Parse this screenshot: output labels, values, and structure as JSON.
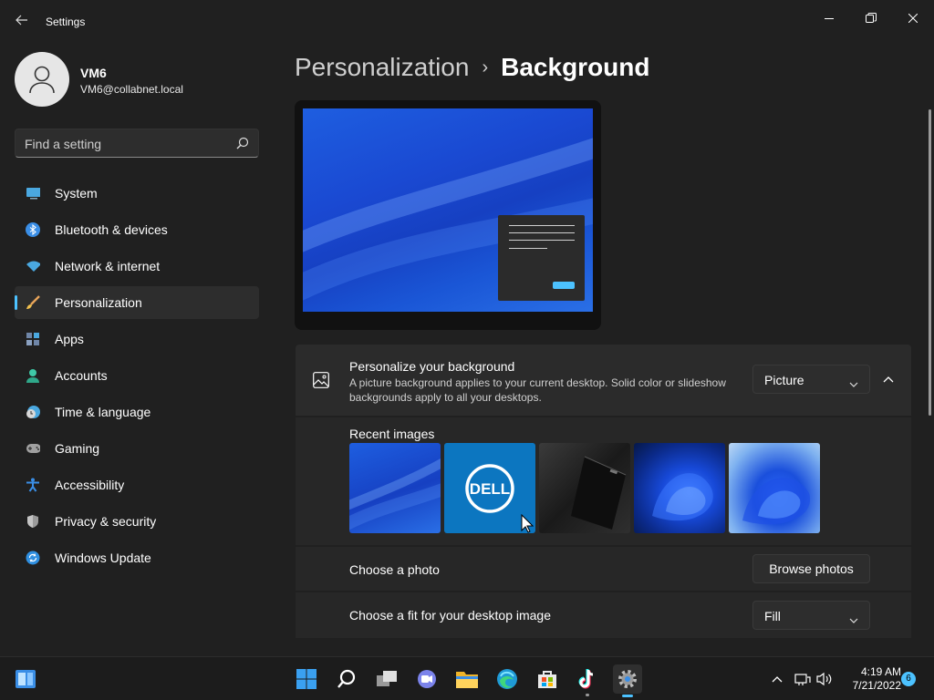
{
  "window": {
    "title": "Settings"
  },
  "profile": {
    "name": "VM6",
    "email": "VM6@collabnet.local"
  },
  "search": {
    "placeholder": "Find a setting"
  },
  "sidebar": {
    "items": [
      {
        "label": "System",
        "icon": "system-icon"
      },
      {
        "label": "Bluetooth & devices",
        "icon": "bluetooth-icon"
      },
      {
        "label": "Network & internet",
        "icon": "wifi-icon"
      },
      {
        "label": "Personalization",
        "icon": "brush-icon",
        "active": true
      },
      {
        "label": "Apps",
        "icon": "apps-icon"
      },
      {
        "label": "Accounts",
        "icon": "accounts-icon"
      },
      {
        "label": "Time & language",
        "icon": "clock-globe-icon"
      },
      {
        "label": "Gaming",
        "icon": "gamepad-icon"
      },
      {
        "label": "Accessibility",
        "icon": "accessibility-icon"
      },
      {
        "label": "Privacy & security",
        "icon": "shield-icon"
      },
      {
        "label": "Windows Update",
        "icon": "update-icon"
      }
    ]
  },
  "breadcrumb": {
    "parent": "Personalization",
    "separator": "›",
    "current": "Background"
  },
  "background_card": {
    "title": "Personalize your background",
    "description": "A picture background applies to your current desktop. Solid color or slideshow backgrounds apply to all your desktops.",
    "type_value": "Picture",
    "recent_label": "Recent images",
    "recent_images": [
      "blue-waves-wallpaper",
      "dell-logo-wallpaper",
      "dark-laptop-wallpaper",
      "windows11-bloom-dark-wallpaper",
      "windows11-bloom-light-wallpaper"
    ],
    "dell_text": "DELL",
    "choose_photo_label": "Choose a photo",
    "browse_button": "Browse photos",
    "fit_label": "Choose a fit for your desktop image",
    "fit_value": "Fill"
  },
  "taskbar": {
    "time": "4:19 AM",
    "date": "7/21/2022",
    "notification_count": "6"
  },
  "colors": {
    "accent": "#4cc2ff",
    "background": "#202020",
    "card": "#2b2b2b"
  }
}
